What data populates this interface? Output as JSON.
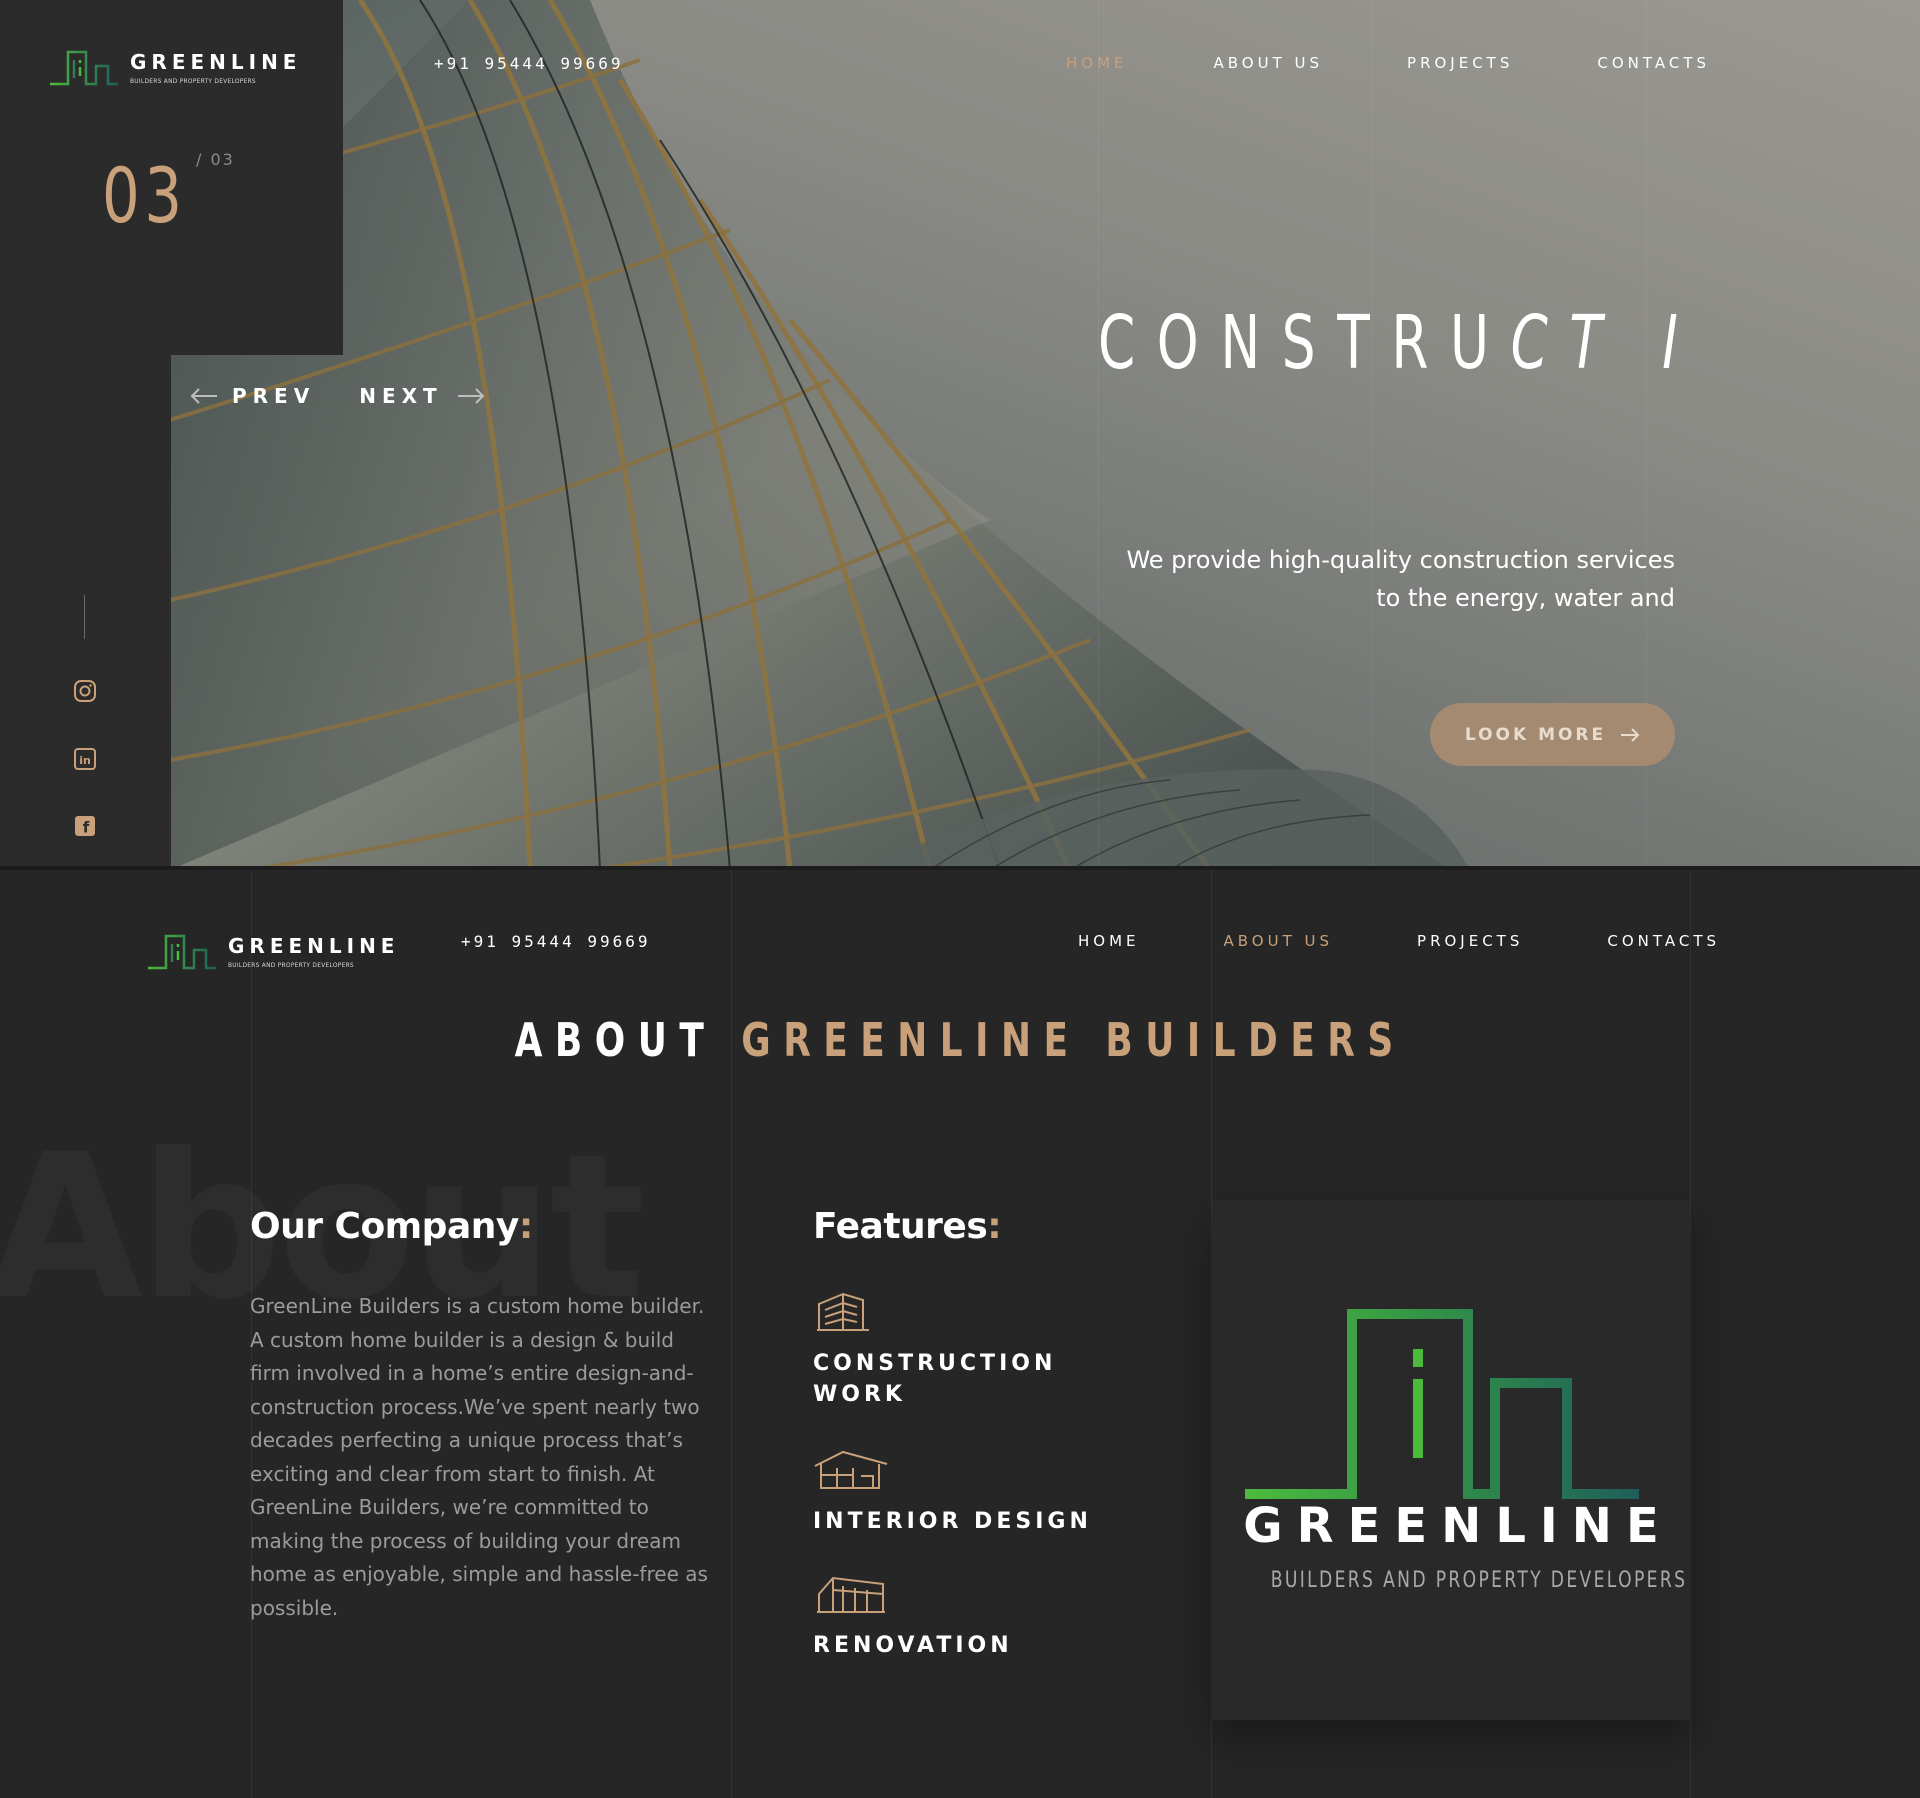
{
  "brand": {
    "name": "GREENLINE",
    "tagline": "BUILDERS AND PROPERTY DEVELOPERS",
    "green_light": "#4cbb3c",
    "green_dark": "#1f5e5a",
    "accent": "#c8a07a"
  },
  "contact": {
    "phone": "+91 95444 99669"
  },
  "hero": {
    "nav": [
      {
        "label": "HOME",
        "active": true
      },
      {
        "label": "ABOUT US",
        "active": false
      },
      {
        "label": "PROJECTS",
        "active": false
      },
      {
        "label": "CONTACTS",
        "active": false
      }
    ],
    "slide_current": "03",
    "slide_total": "/ 03",
    "prev_label": "PREV",
    "next_label": "NEXT",
    "title_upright": "CONSTRU",
    "title_italic": "CT I",
    "subtitle": "We provide high-quality construction services to the energy, water and",
    "cta_label": "LOOK MORE",
    "social_icons": [
      "instagram-icon",
      "linkedin-icon",
      "facebook-icon"
    ]
  },
  "about": {
    "nav": [
      {
        "label": "HOME",
        "active": false
      },
      {
        "label": "ABOUT US",
        "active": true
      },
      {
        "label": "PROJECTS",
        "active": false
      },
      {
        "label": "CONTACTS",
        "active": false
      }
    ],
    "heading_white": "ABOUT",
    "heading_accent": "GREENLINE BUILDERS",
    "background_word": "About",
    "company_title": "Our Company",
    "company_text": "GreenLine Builders is a custom home builder. A custom home builder is a design & build firm involved in a home’s entire design-and-construction process.We’ve spent nearly two decades perfecting a unique process that’s exciting and clear from start to finish. At GreenLine Builders, we’re committed to making the process of building your dream home as enjoyable, simple and hassle-free as possible.",
    "features_title": "Features",
    "features": [
      {
        "icon": "construction-icon",
        "label": "CONSTRUCTION WORK"
      },
      {
        "icon": "interior-house-icon",
        "label": "INTERIOR DESIGN"
      },
      {
        "icon": "renovation-icon",
        "label": "RENOVATION"
      }
    ]
  }
}
